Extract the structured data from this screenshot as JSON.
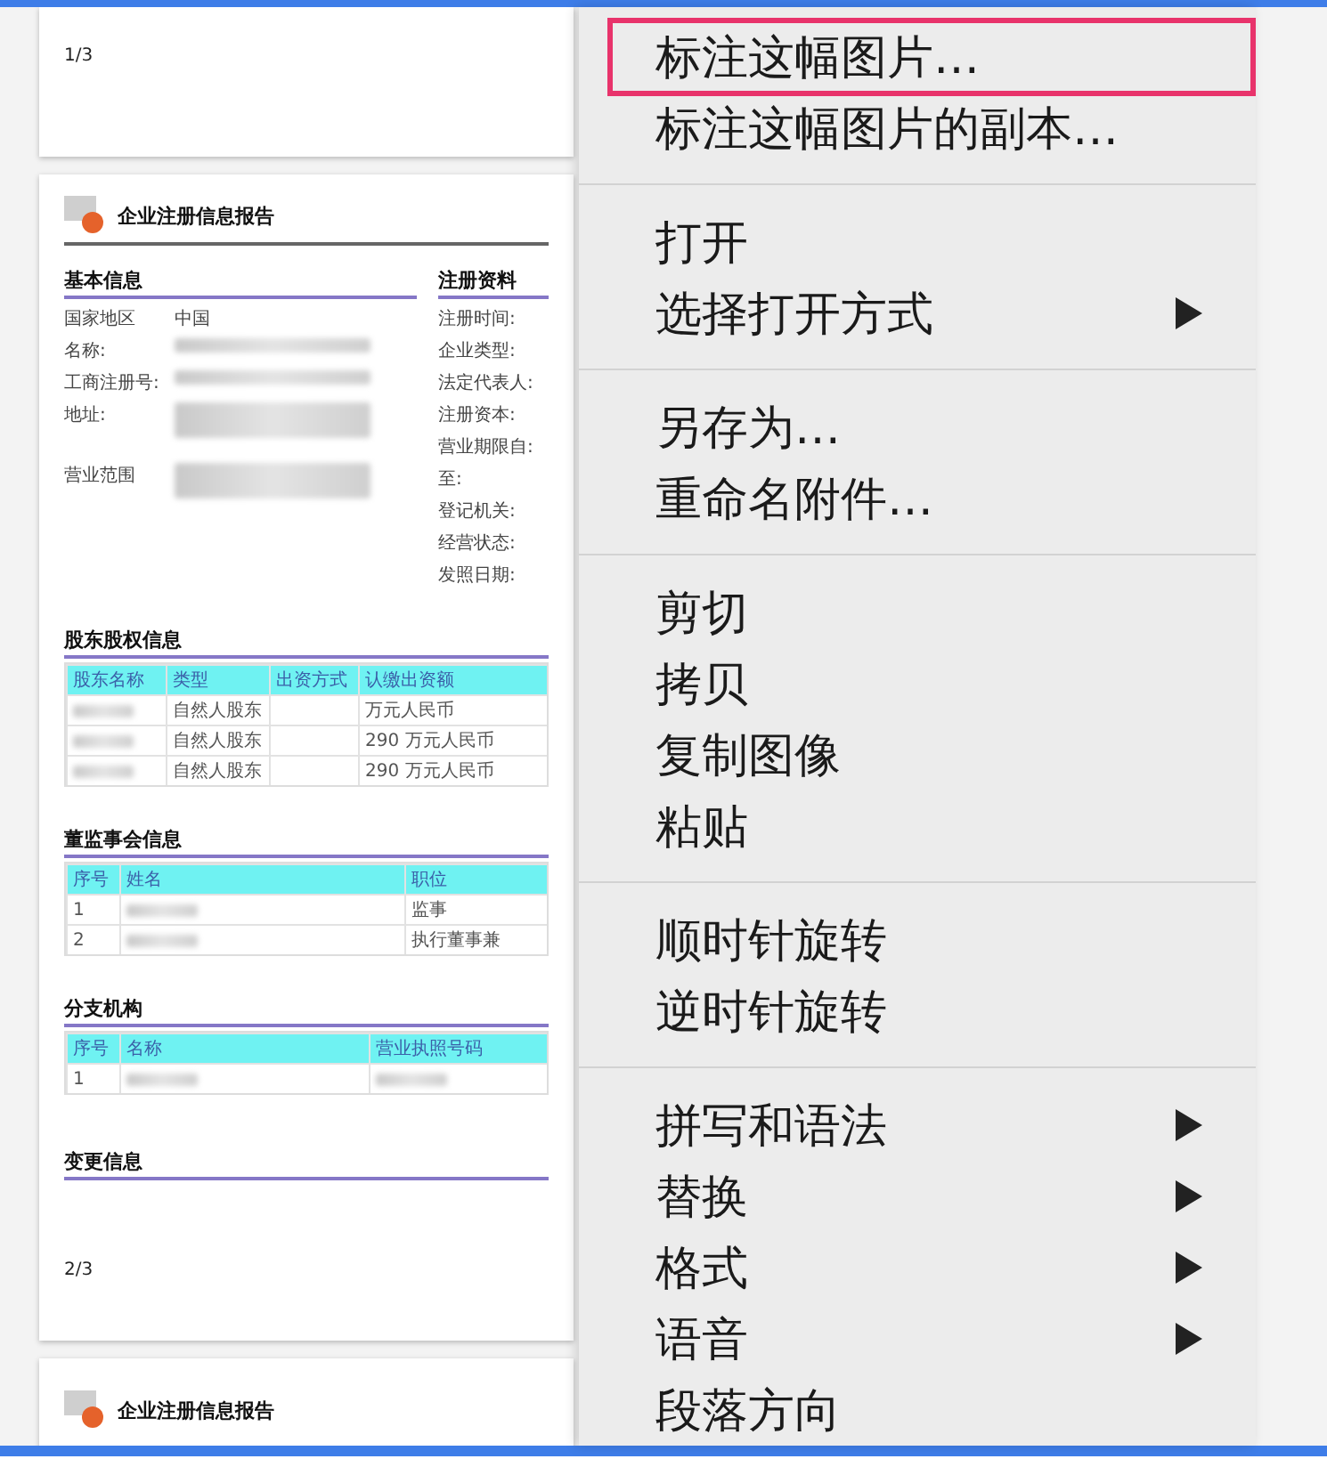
{
  "document": {
    "pages": [
      {
        "kind": "footer",
        "page_number": "1/3"
      },
      {
        "kind": "report",
        "title": "企业注册信息报告",
        "basic": {
          "heading": "基本信息",
          "rows": [
            {
              "label": "国家地区",
              "value": "中国"
            },
            {
              "label": "名称:",
              "redacted": true
            },
            {
              "label": "工商注册号:",
              "redacted": true
            },
            {
              "label": "地址:",
              "redacted": true
            },
            {
              "label": "营业范围",
              "redacted": true
            }
          ]
        },
        "registration": {
          "heading": "注册资料",
          "labels": [
            "注册时间:",
            "企业类型:",
            "法定代表人:",
            "注册资本:",
            "营业期限自:",
            "至:",
            "登记机关:",
            "经营状态:",
            "发照日期:"
          ]
        },
        "tables": [
          {
            "heading": "股东股权信息",
            "columns": [
              "股东名称",
              "类型",
              "出资方式",
              "认缴出资额"
            ],
            "rows": [
              [
                {
                  "kind": "redacted"
                },
                {
                  "kind": "text",
                  "text": "自然人股东"
                },
                {
                  "kind": "blank"
                },
                {
                  "kind": "text",
                  "text": "万元人民币"
                }
              ],
              [
                {
                  "kind": "redacted"
                },
                {
                  "kind": "text",
                  "text": "自然人股东"
                },
                {
                  "kind": "blank"
                },
                {
                  "kind": "text",
                  "text": "290 万元人民币"
                }
              ],
              [
                {
                  "kind": "redacted"
                },
                {
                  "kind": "text",
                  "text": "自然人股东"
                },
                {
                  "kind": "blank"
                },
                {
                  "kind": "text",
                  "text": "290 万元人民币"
                }
              ]
            ]
          },
          {
            "heading": "董监事会信息",
            "columns": [
              "序号",
              "姓名",
              "职位"
            ],
            "rows": [
              [
                {
                  "kind": "text",
                  "text": "1"
                },
                {
                  "kind": "redacted"
                },
                {
                  "kind": "text",
                  "text": "监事"
                }
              ],
              [
                {
                  "kind": "text",
                  "text": "2"
                },
                {
                  "kind": "redacted"
                },
                {
                  "kind": "text",
                  "text": "执行董事兼"
                }
              ]
            ]
          },
          {
            "heading": "分支机构",
            "columns": [
              "序号",
              "名称",
              "营业执照号码"
            ],
            "rows": [
              [
                {
                  "kind": "text",
                  "text": "1"
                },
                {
                  "kind": "redacted"
                },
                {
                  "kind": "redacted"
                }
              ]
            ]
          }
        ],
        "last_heading": "变更信息",
        "page_number": "2/3"
      },
      {
        "kind": "header",
        "title": "企业注册信息报告"
      }
    ]
  },
  "context_menu": {
    "groups": [
      [
        {
          "label": "标注这幅图片…",
          "highlighted": true,
          "submenu": false
        },
        {
          "label": "标注这幅图片的副本…",
          "highlighted": false,
          "submenu": false
        }
      ],
      [
        {
          "label": "打开",
          "highlighted": false,
          "submenu": false
        },
        {
          "label": "选择打开方式",
          "highlighted": false,
          "submenu": true
        }
      ],
      [
        {
          "label": "另存为…",
          "highlighted": false,
          "submenu": false
        },
        {
          "label": "重命名附件…",
          "highlighted": false,
          "submenu": false
        }
      ],
      [
        {
          "label": "剪切",
          "highlighted": false,
          "submenu": false
        },
        {
          "label": "拷贝",
          "highlighted": false,
          "submenu": false
        },
        {
          "label": "复制图像",
          "highlighted": false,
          "submenu": false
        },
        {
          "label": "粘贴",
          "highlighted": false,
          "submenu": false
        }
      ],
      [
        {
          "label": "顺时针旋转",
          "highlighted": false,
          "submenu": false
        },
        {
          "label": "逆时针旋转",
          "highlighted": false,
          "submenu": false
        }
      ],
      [
        {
          "label": "拼写和语法",
          "highlighted": false,
          "submenu": true
        },
        {
          "label": "替换",
          "highlighted": false,
          "submenu": true
        },
        {
          "label": "格式",
          "highlighted": false,
          "submenu": true
        },
        {
          "label": "语音",
          "highlighted": false,
          "submenu": true
        },
        {
          "label": "段落方向",
          "highlighted": false,
          "submenu": false
        }
      ]
    ]
  }
}
